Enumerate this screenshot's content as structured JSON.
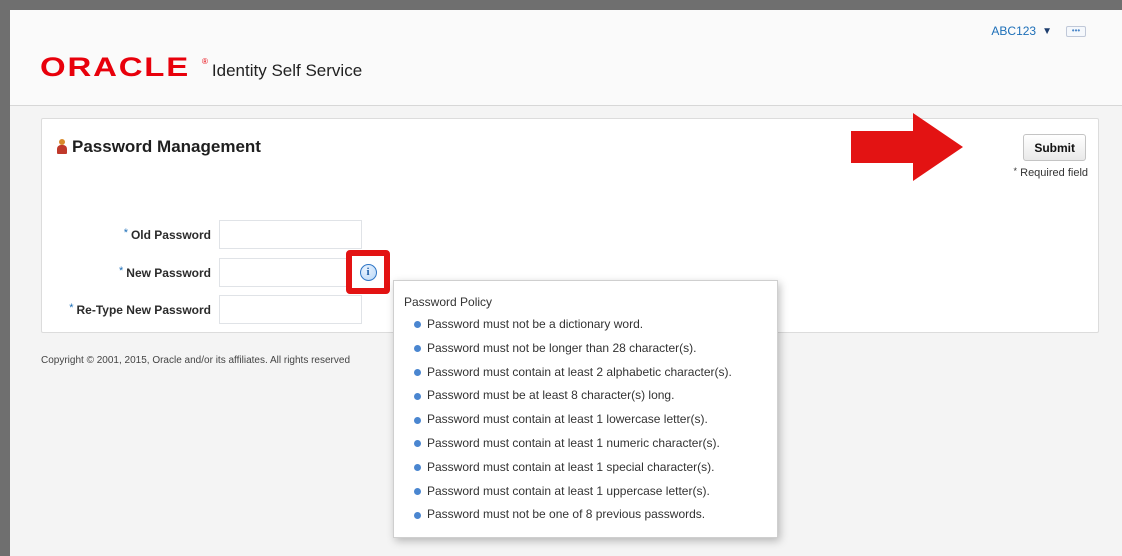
{
  "header": {
    "logo_text": "ORACLE",
    "logo_reg": "®",
    "product_name": "Identity Self Service",
    "user_name": "ABC123",
    "more_icon": "more-icon"
  },
  "panel": {
    "title": "Password Management",
    "submit_label": "Submit",
    "required_star": "*",
    "required_text": "Required field"
  },
  "form": {
    "fields": [
      {
        "label": "Old Password",
        "value": ""
      },
      {
        "label": "New Password",
        "value": ""
      },
      {
        "label": "Re-Type New Password",
        "value": ""
      }
    ],
    "required_marker": "*"
  },
  "policy": {
    "title": "Password Policy",
    "rules": [
      "Password must not be a dictionary word.",
      "Password must not be longer than 28 character(s).",
      "Password must contain at least 2 alphabetic character(s).",
      "Password must be at least 8 character(s) long.",
      "Password must contain at least 1 lowercase letter(s).",
      "Password must contain at least 1 numeric character(s).",
      "Password must contain at least 1 special character(s).",
      "Password must contain at least 1 uppercase letter(s).",
      "Password must not be one of 8 previous passwords."
    ]
  },
  "footer": {
    "copyright": "Copyright © 2001, 2015, Oracle and/or its affiliates. All rights reserved"
  },
  "colors": {
    "brand": "#e8000b",
    "annotation": "#e31313",
    "link": "#1d6fb8"
  }
}
